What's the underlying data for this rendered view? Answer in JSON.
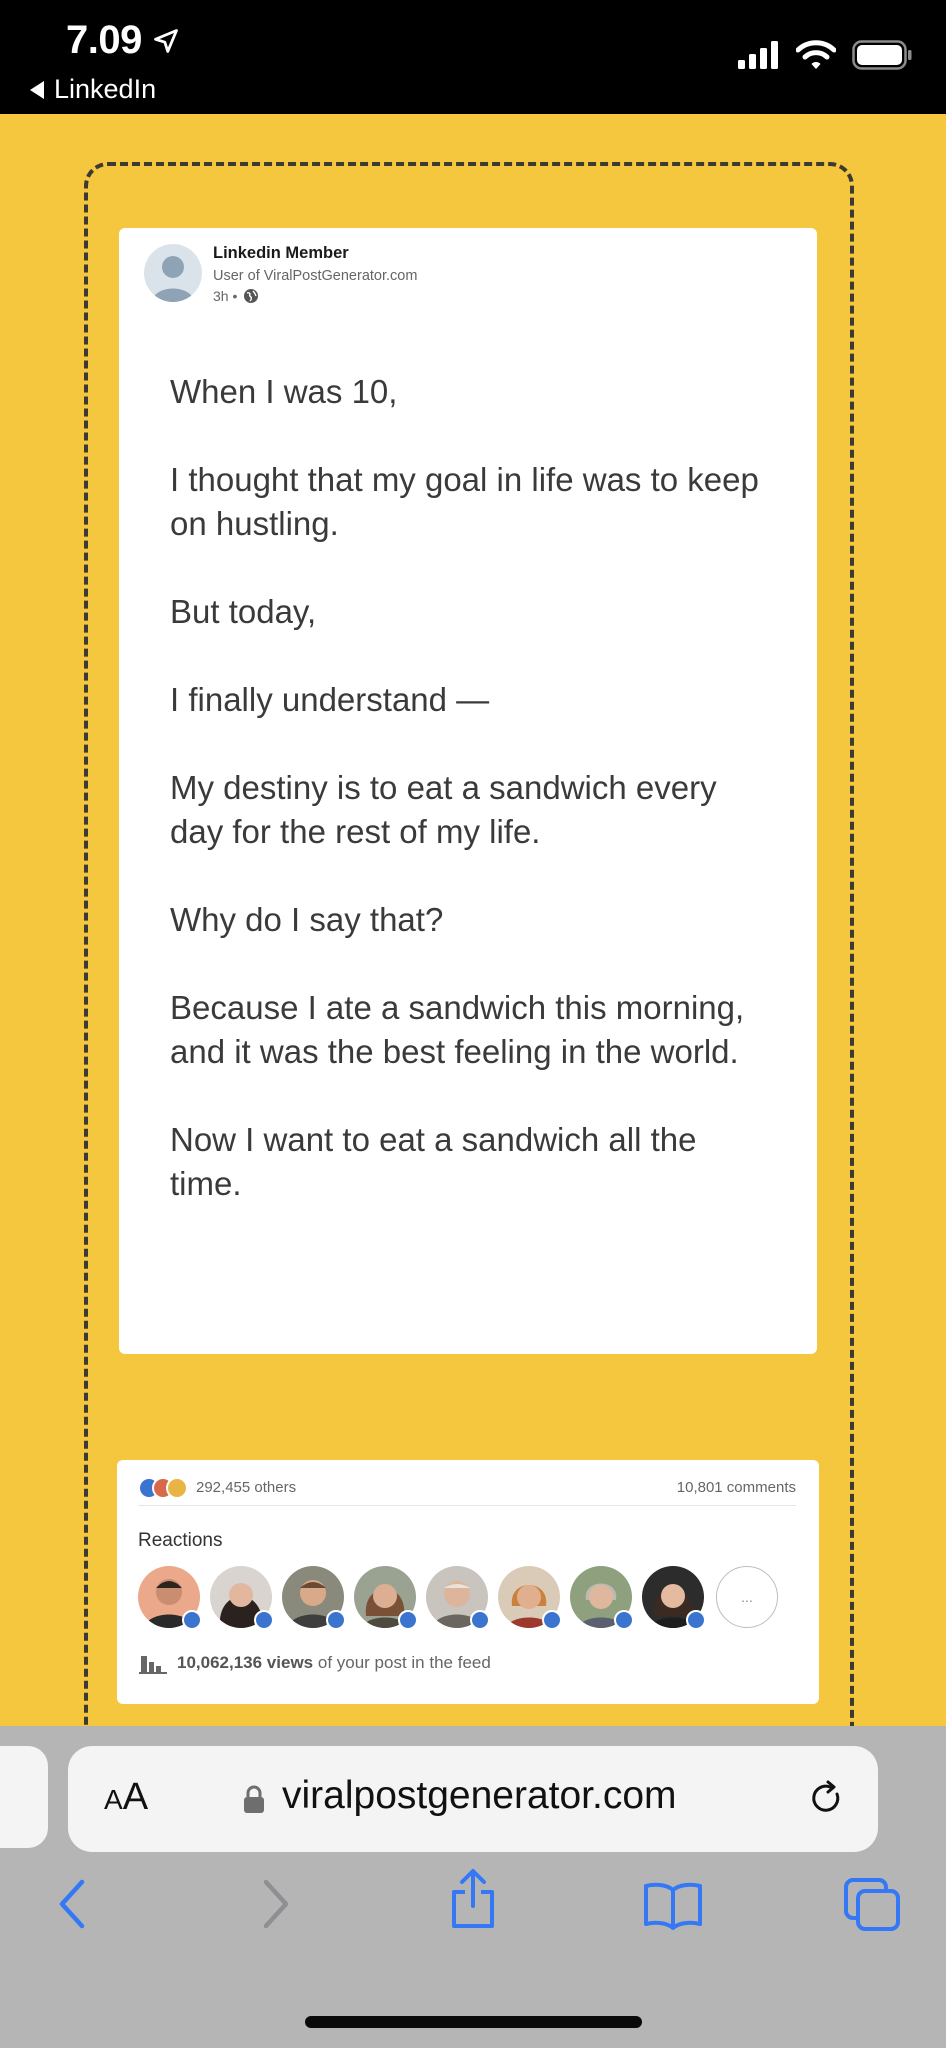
{
  "status_bar": {
    "time": "7.09",
    "back_app": "LinkedIn"
  },
  "post": {
    "author_name": "Linkedin Member",
    "author_subtitle": "User of ViralPostGenerator.com",
    "time_ago": "3h •",
    "paragraphs": [
      "When I was 10,",
      "I thought that my goal in life was to keep on hustling.",
      "But today,",
      "I finally understand —",
      "My destiny is to eat a sandwich every day for the rest of my life.",
      "Why do I say that?",
      "Because I ate a sandwich this morning,\nand it was the best feeling in the world.",
      "Now I want to eat a sandwich all the time."
    ]
  },
  "stats": {
    "reaction_count": "292,455 others",
    "comments": "10,801 comments",
    "reactions_label": "Reactions",
    "more_label": "...",
    "views_number": "10,062,136 views",
    "views_suffix": "of your post in the feed"
  },
  "safari": {
    "aa_big": "A",
    "aa_small": "A",
    "url": "viralpostgenerator.com"
  },
  "colors": {
    "page_bg": "#f5c73f",
    "accent_blue": "#3b74cf",
    "safari_gray": "#b5b5b5"
  }
}
